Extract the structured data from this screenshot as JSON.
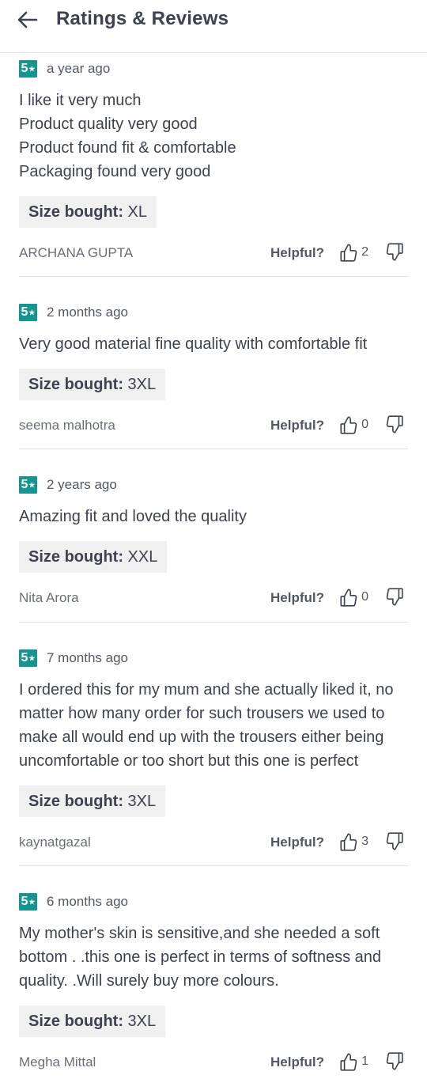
{
  "header": {
    "title": "Ratings & Reviews"
  },
  "labels": {
    "helpful": "Helpful?",
    "size_bought": "Size bought:"
  },
  "colors": {
    "rating_badge": "#14958f"
  },
  "reviews": [
    {
      "rating": "5",
      "age": "a year ago",
      "text": "I like it very much\nProduct quality very good\nProduct found fit & comfortable\nPackaging found very good",
      "size": "XL",
      "reviewer": "ARCHANA GUPTA",
      "helpful_count": "2"
    },
    {
      "rating": "5",
      "age": "2 months ago",
      "text": "Very good material fine quality with comfortable fit",
      "size": "3XL",
      "reviewer": "seema malhotra",
      "helpful_count": "0"
    },
    {
      "rating": "5",
      "age": "2 years ago",
      "text": "Amazing fit and loved the quality",
      "size": "XXL",
      "reviewer": "Nita Arora",
      "helpful_count": "0"
    },
    {
      "rating": "5",
      "age": "7 months ago",
      "text": "I ordered this for my mum and she actually liked it, no\nmatter how many order for such trousers we used to\nmake all would end up with the trousers either being\nuncomfortable or too short but this one is perfect",
      "size": "3XL",
      "reviewer": "kaynatgazal",
      "helpful_count": "3"
    },
    {
      "rating": "5",
      "age": "6 months ago",
      "text": "My mother's skin is sensitive,and she needed a soft\nbottom . .this one is perfect in terms of softness and\nquality. .Will surely buy more colours.",
      "size": "3XL",
      "reviewer": "Megha Mittal",
      "helpful_count": "1"
    }
  ]
}
